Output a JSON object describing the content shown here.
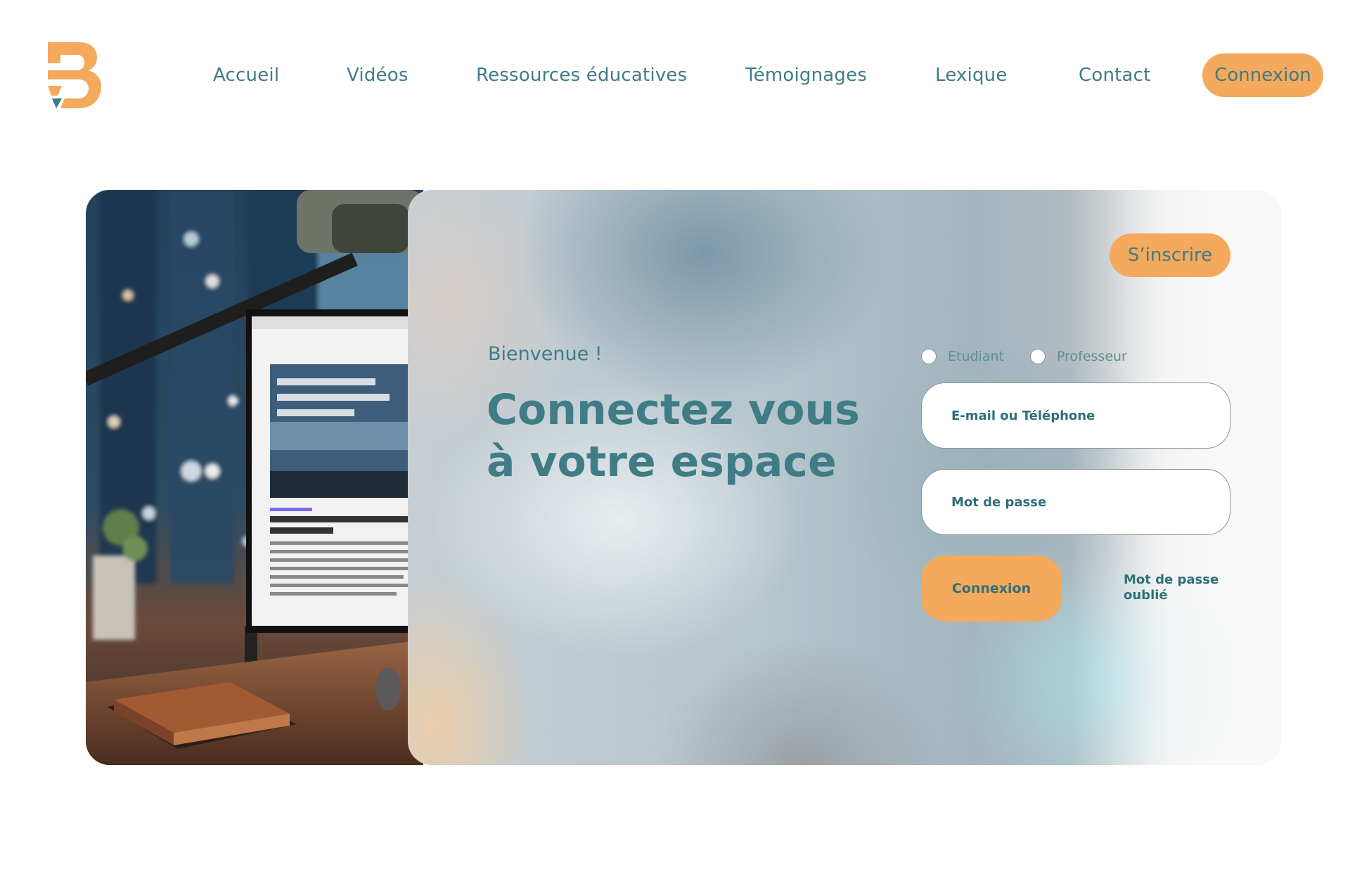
{
  "brand": {
    "logo_icon": "b-logo-icon",
    "accent_color": "#f4a95c",
    "text_color": "#3f7c86"
  },
  "nav": {
    "items": [
      {
        "label": "Accueil"
      },
      {
        "label": "Vidéos"
      },
      {
        "label": "Ressources éducatives"
      },
      {
        "label": "Témoignages"
      },
      {
        "label": "Lexique"
      },
      {
        "label": "Contact"
      }
    ],
    "cta_label": "Connexion"
  },
  "hero": {
    "welcome": "Bienvenue !",
    "headline_line1": "Connectez vous",
    "headline_line2": "à votre espace",
    "signup_label": "S’inscrire",
    "photo_icon": "desk-monitor-photo"
  },
  "login_form": {
    "roles": [
      {
        "label": "Etudiant",
        "selected": false
      },
      {
        "label": "Professeur",
        "selected": false
      }
    ],
    "email_placeholder": "E-mail ou Téléphone",
    "password_placeholder": "Mot de passe",
    "submit_label": "Connexion",
    "forgot_label": "Mot de passe oublié"
  }
}
